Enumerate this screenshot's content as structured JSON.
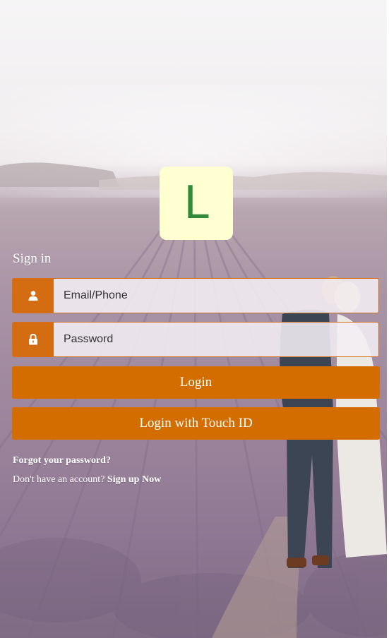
{
  "logo": {
    "letter": "L"
  },
  "form": {
    "title": "Sign in",
    "email": {
      "placeholder": "Email/Phone",
      "value": "",
      "icon": "user-icon"
    },
    "password": {
      "placeholder": "Password",
      "value": "",
      "icon": "lock-icon"
    },
    "login_label": "Login",
    "touch_id_label": "Login with Touch ID"
  },
  "links": {
    "forgot_password": "Forgot your password?",
    "no_account_text": "Don't have an account?",
    "signup_label": "Sign up Now"
  },
  "colors": {
    "accent": "#d46d00",
    "logo_bg": "#ffffd2",
    "logo_letter": "#2e8b3a"
  }
}
